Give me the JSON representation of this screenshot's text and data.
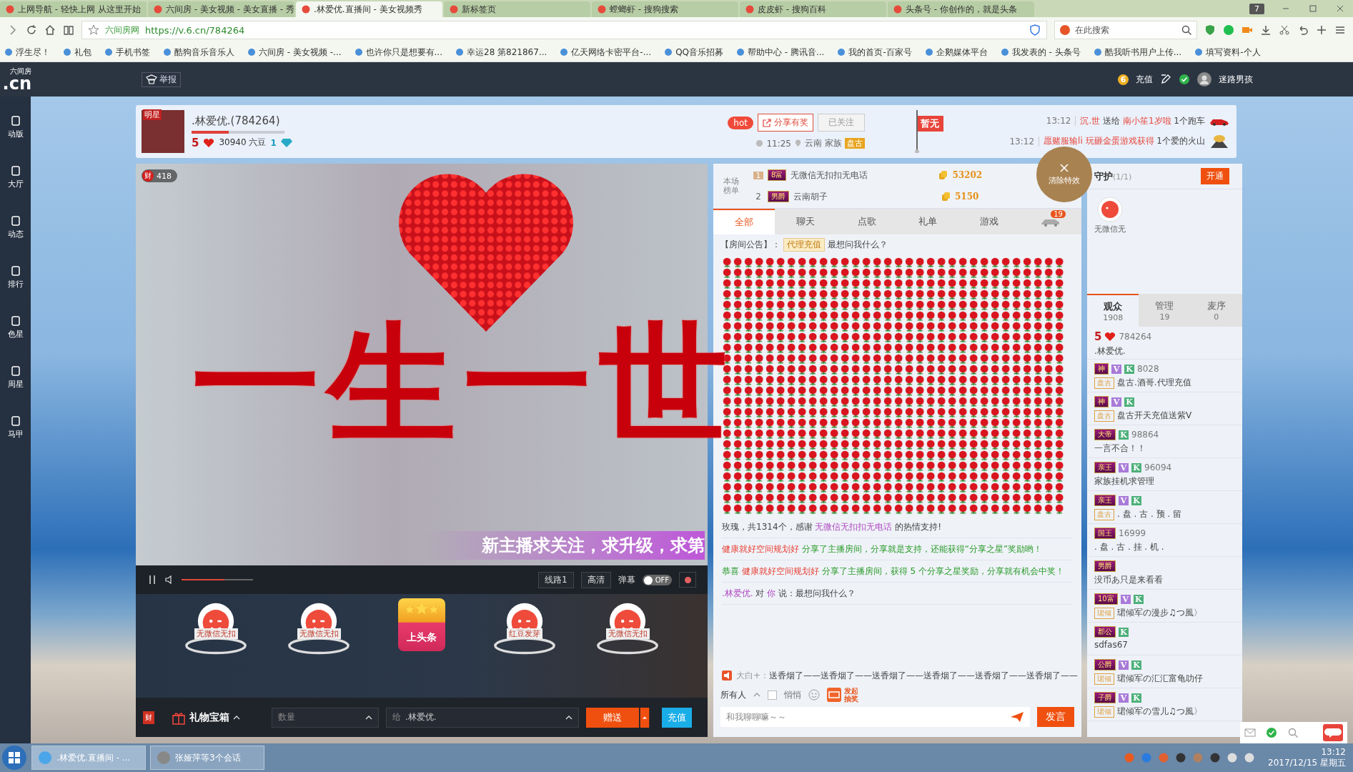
{
  "browser": {
    "tabs": [
      {
        "title": "上网导航 - 轻快上网 从这里开始",
        "selected": false
      },
      {
        "title": "六间房 - 美女视频 - 美女直播 - 秀",
        "selected": false
      },
      {
        "title": ".林爱优.直播间 - 美女视频秀",
        "selected": true
      },
      {
        "title": "新标签页",
        "selected": false
      },
      {
        "title": "螳螂虾 - 搜狗搜索",
        "selected": false
      },
      {
        "title": "皮皮虾 - 搜狗百科",
        "selected": false
      },
      {
        "title": "头条号 - 你创作的，就是头条",
        "selected": false
      }
    ],
    "tab_count": "7",
    "site_label": "六间房网",
    "url": "https://v.6.cn/784264",
    "search_placeholder": "在此搜索",
    "bookmarks": [
      "浮生尽！",
      "礼包",
      "手机书签",
      "酷狗音乐音乐人",
      "六间房 - 美女视频 -...",
      "也许你只是想要有...",
      "幸运28 第821867...",
      "亿天网络卡密平台-...",
      "QQ音乐招募",
      "帮助中心 - 腾讯音...",
      "我的首页-百家号",
      "企鹅媒体平台",
      "我发表的 - 头条号",
      "酷我听书用户上传...",
      "填写资料-个人"
    ]
  },
  "site_header": {
    "logo_top": "六间房",
    "logo_bottom": ".cn",
    "report": "举报",
    "coin": "6",
    "recharge": "充值",
    "username": "迷路男孩"
  },
  "sidebar": [
    "动版",
    "大厅",
    "动态",
    "排行",
    "色星",
    "周星",
    "马甲"
  ],
  "streamer": {
    "tag": "明星",
    "name": ".林爱优.(784264)",
    "level": 0.4,
    "rank": "5",
    "beans": "30940 六豆",
    "diamonds": "1",
    "hot": "hot",
    "share": "分享有奖",
    "follow": "已关注",
    "time": "11:25",
    "location": "云南",
    "family_label": "家族",
    "family": "盘古",
    "flag": "暂无"
  },
  "feed": [
    {
      "time": "13:12",
      "kind": "car",
      "segments": [
        {
          "text": "沉.世",
          "kind": "name"
        },
        {
          "text": " 送给 ",
          "kind": "plain"
        },
        {
          "text": "南小笙1岁啦",
          "kind": "name"
        },
        {
          "text": " 1个跑车",
          "kind": "plain"
        }
      ]
    },
    {
      "time": "13:12",
      "kind": "volcano",
      "segments": [
        {
          "text": "愿赌服输li 玩砸金蛋游戏获得",
          "kind": "name"
        },
        {
          "text": " 1个爱的火山",
          "kind": "plain"
        }
      ]
    }
  ],
  "video": {
    "wealth_badge": "财",
    "wealth": "418",
    "effect_text": "一生一世",
    "banner": "新主播求关注，求升级，求第",
    "controls": {
      "volume": {
        "level": 0.6
      },
      "line": "线路1",
      "quality": "高清",
      "danmaku": {
        "label": "弹幕",
        "state": "OFF",
        "on": false
      }
    },
    "gifts": [
      {
        "label": "无微信无扣",
        "kind": "mascot"
      },
      {
        "label": "无微信无扣",
        "kind": "mascot"
      },
      {
        "label": "上头条",
        "kind": "headline"
      },
      {
        "label": "红豆发芽",
        "kind": "mascot"
      },
      {
        "label": "无微信无扣",
        "kind": "mascot"
      }
    ],
    "bottom": {
      "wealth": "财",
      "gift_box": "礼物宝箱",
      "quantity_placeholder": "数量",
      "to_label": "给",
      "to_value": ".林爱优.",
      "send": "赠送",
      "recharge": "充值"
    }
  },
  "ranking": {
    "title": "本场榜单",
    "rows": [
      {
        "rank": "1",
        "badge": "8富",
        "name": "无微信无扣扣无电话",
        "score": "53202"
      },
      {
        "rank": "2",
        "badge": "男爵",
        "name": "云南胡子",
        "score": "5150"
      }
    ]
  },
  "clear_effects": "清除特效",
  "chat": {
    "tabs": [
      {
        "label": "全部",
        "selected": true
      },
      {
        "label": "聊天",
        "selected": false
      },
      {
        "label": "点歌",
        "selected": false
      },
      {
        "label": "礼单",
        "selected": false
      },
      {
        "label": "游戏",
        "selected": false
      }
    ],
    "car_count": "19",
    "notice": {
      "label": "【房间公告】：",
      "tag": "代理充值",
      "text": "最想问我什么？"
    },
    "messages": [
      {
        "kind": "roses",
        "segments": [
          {
            "text": "玫瑰，共1314个，感谢 ",
            "kind": "plain"
          },
          {
            "text": "无微信无扣扣无电话",
            "kind": "link"
          },
          {
            "text": " 的热情支持!",
            "kind": "plain"
          }
        ]
      },
      {
        "kind": "text",
        "segments": [
          {
            "text": "健康就好空间规划好",
            "kind": "name"
          },
          {
            "text": " 分享了主播房间，分享就是支持，还能获得“分享之星”奖励哟！",
            "kind": "green"
          }
        ]
      },
      {
        "kind": "text",
        "segments": [
          {
            "text": "恭喜 ",
            "kind": "green"
          },
          {
            "text": "健康就好空间规划好",
            "kind": "name"
          },
          {
            "text": " 分享了主播房间，获得 5 个分享之星奖励，分享就有机会中奖！",
            "kind": "green"
          }
        ]
      },
      {
        "kind": "text",
        "segments": [
          {
            "text": ".林爱优.",
            "kind": "link"
          },
          {
            "text": " 对 ",
            "kind": "plain"
          },
          {
            "text": "你",
            "kind": "link"
          },
          {
            "text": " 说：最想问我什么？",
            "kind": "plain"
          }
        ]
      }
    ],
    "broadcast": {
      "user": "大白+：",
      "text": "送香烟了——送香烟了——送香烟了——送香烟了——送香烟了——送香烟了——"
    },
    "recipient": "所有人",
    "whisper": {
      "label": "悄悄",
      "checked": false
    },
    "lottery": "发起抽奖",
    "input_placeholder": "和我聊聊嘛～～",
    "send": "发言"
  },
  "guard": {
    "title": "守护",
    "count": "(1/1)",
    "open": "开通",
    "members": [
      "无微信无"
    ]
  },
  "audience": {
    "tabs": [
      {
        "label": "观众",
        "count": "1908",
        "selected": true
      },
      {
        "label": "管理",
        "count": "19",
        "selected": false
      },
      {
        "label": "麦序",
        "count": "0",
        "selected": false
      }
    ],
    "users": [
      {
        "kind": "host",
        "badge": "5",
        "id": "784264",
        "name": ".林爱优."
      },
      {
        "kind": "user",
        "badge": "神",
        "tags": [
          {
            "text": "V",
            "kind": "vip"
          },
          {
            "text": "K",
            "kind": "k"
          }
        ],
        "id": "8028",
        "family": "盘古",
        "name": "盘古.酒哥.代理充值"
      },
      {
        "kind": "user",
        "badge": "神",
        "tags": [
          {
            "text": "V",
            "kind": "vip"
          },
          {
            "text": "K",
            "kind": "k"
          }
        ],
        "family": "盘古",
        "name": "盘古开天充值送紫V"
      },
      {
        "kind": "user",
        "badge": "大帝",
        "tags": [
          {
            "text": "K",
            "kind": "k"
          }
        ],
        "id": "98864",
        "name": "一言不合！！"
      },
      {
        "kind": "user",
        "badge": "亲王",
        "tags": [
          {
            "text": "V",
            "kind": "vip"
          },
          {
            "text": "K",
            "kind": "k"
          }
        ],
        "id": "96094",
        "name": "家族挂机求管理"
      },
      {
        "kind": "user",
        "badge": "亲王",
        "tags": [
          {
            "text": "V",
            "kind": "vip"
          },
          {
            "text": "K",
            "kind": "k"
          }
        ],
        "family": "盘古",
        "name": ". 盘 . 古 . 预 . 留"
      },
      {
        "kind": "user",
        "badge": "国王",
        "id": "16999",
        "name": ". 盘 . 古 . 挂 . 机 ."
      },
      {
        "kind": "user",
        "badge": "男爵",
        "name": "没币あ只是来看看"
      },
      {
        "kind": "user",
        "badge": "10富",
        "tags": [
          {
            "text": "V",
            "kind": "vip"
          },
          {
            "text": "K",
            "kind": "k"
          }
        ],
        "family": "珺倾",
        "name": "珺倾军の漫步♫つ風〉"
      },
      {
        "kind": "user",
        "badge": "郡公",
        "tags": [
          {
            "text": "K",
            "kind": "k"
          }
        ],
        "name": "sdfas67"
      },
      {
        "kind": "user",
        "badge": "公爵",
        "tags": [
          {
            "text": "V",
            "kind": "vip"
          },
          {
            "text": "K",
            "kind": "k"
          }
        ],
        "family": "珺倾",
        "name": "珺倾军の汇汇富龟叻仔"
      },
      {
        "kind": "user",
        "badge": "子爵",
        "tags": [
          {
            "text": "V",
            "kind": "vip"
          },
          {
            "text": "K",
            "kind": "k"
          }
        ],
        "family": "珺倾",
        "name": "珺倾军の雪儿♫つ風〉"
      }
    ]
  },
  "taskbar": {
    "windows": [
      {
        "title": ".林爱优.直播间 - ...",
        "selected": true
      },
      {
        "title": "张娅萍等3个会话",
        "selected": false
      }
    ],
    "time": "13:12",
    "date": "2017/12/15 星期五"
  }
}
